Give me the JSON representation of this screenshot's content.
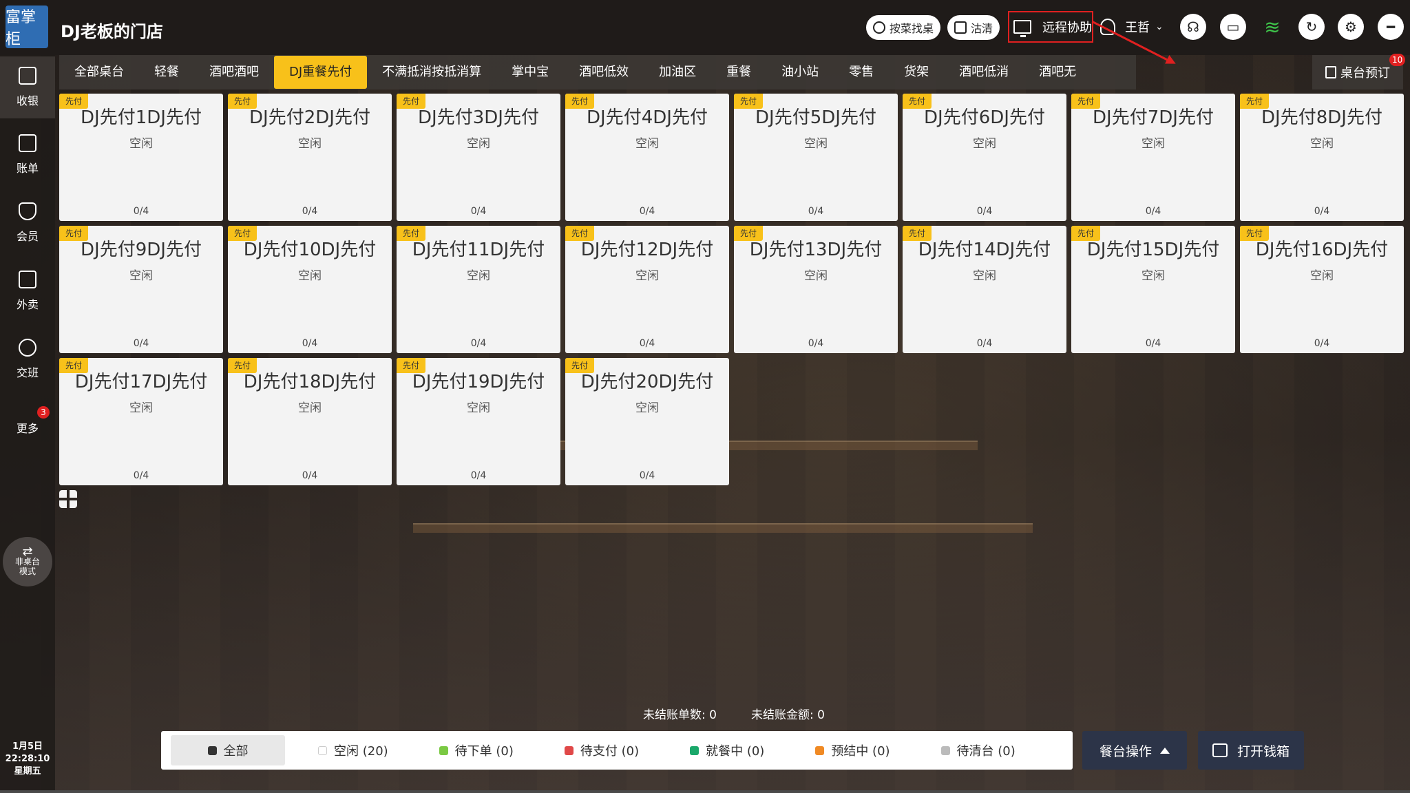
{
  "header": {
    "logo_text": "富掌柜",
    "store_name": "DJ老板的门店",
    "search_dish_label": "按菜找桌",
    "clean_label": "沽清",
    "remote_assist_label": "远程协助",
    "user_name": "王哲"
  },
  "sidebar": {
    "items": [
      {
        "label": "收银"
      },
      {
        "label": "账单"
      },
      {
        "label": "会员"
      },
      {
        "label": "外卖"
      },
      {
        "label": "交班"
      },
      {
        "label": "更多",
        "badge": "3"
      }
    ],
    "mode_label_1": "非桌台",
    "mode_label_2": "模式",
    "date": "1月5日",
    "time": "22:28:10",
    "weekday": "星期五"
  },
  "tabs": [
    "全部桌台",
    "轻餐",
    "酒吧酒吧",
    "DJ重餐先付",
    "不满抵消按抵消算",
    "掌中宝",
    "酒吧低效",
    "加油区",
    "重餐",
    "油小站",
    "零售",
    "货架",
    "酒吧低消",
    "酒吧无"
  ],
  "active_tab": "DJ重餐先付",
  "reserve": {
    "label": "桌台预订",
    "badge": "10"
  },
  "tables": [
    {
      "tag": "先付",
      "name": "DJ先付1DJ先付",
      "status": "空闲",
      "seats": "0/4"
    },
    {
      "tag": "先付",
      "name": "DJ先付2DJ先付",
      "status": "空闲",
      "seats": "0/4"
    },
    {
      "tag": "先付",
      "name": "DJ先付3DJ先付",
      "status": "空闲",
      "seats": "0/4"
    },
    {
      "tag": "先付",
      "name": "DJ先付4DJ先付",
      "status": "空闲",
      "seats": "0/4"
    },
    {
      "tag": "先付",
      "name": "DJ先付5DJ先付",
      "status": "空闲",
      "seats": "0/4"
    },
    {
      "tag": "先付",
      "name": "DJ先付6DJ先付",
      "status": "空闲",
      "seats": "0/4"
    },
    {
      "tag": "先付",
      "name": "DJ先付7DJ先付",
      "status": "空闲",
      "seats": "0/4"
    },
    {
      "tag": "先付",
      "name": "DJ先付8DJ先付",
      "status": "空闲",
      "seats": "0/4"
    },
    {
      "tag": "先付",
      "name": "DJ先付9DJ先付",
      "status": "空闲",
      "seats": "0/4"
    },
    {
      "tag": "先付",
      "name": "DJ先付10DJ先付",
      "status": "空闲",
      "seats": "0/4"
    },
    {
      "tag": "先付",
      "name": "DJ先付11DJ先付",
      "status": "空闲",
      "seats": "0/4"
    },
    {
      "tag": "先付",
      "name": "DJ先付12DJ先付",
      "status": "空闲",
      "seats": "0/4"
    },
    {
      "tag": "先付",
      "name": "DJ先付13DJ先付",
      "status": "空闲",
      "seats": "0/4"
    },
    {
      "tag": "先付",
      "name": "DJ先付14DJ先付",
      "status": "空闲",
      "seats": "0/4"
    },
    {
      "tag": "先付",
      "name": "DJ先付15DJ先付",
      "status": "空闲",
      "seats": "0/4"
    },
    {
      "tag": "先付",
      "name": "DJ先付16DJ先付",
      "status": "空闲",
      "seats": "0/4"
    },
    {
      "tag": "先付",
      "name": "DJ先付17DJ先付",
      "status": "空闲",
      "seats": "0/4"
    },
    {
      "tag": "先付",
      "name": "DJ先付18DJ先付",
      "status": "空闲",
      "seats": "0/4"
    },
    {
      "tag": "先付",
      "name": "DJ先付19DJ先付",
      "status": "空闲",
      "seats": "0/4"
    },
    {
      "tag": "先付",
      "name": "DJ先付20DJ先付",
      "status": "空闲",
      "seats": "0/4"
    }
  ],
  "summary": {
    "unsettled_orders": "未结账单数: 0",
    "unsettled_amount": "未结账金额: 0"
  },
  "legend": [
    {
      "label": "全部",
      "color": "#333333"
    },
    {
      "label": "空闲 (20)",
      "color": "#ffffff"
    },
    {
      "label": "待下单 (0)",
      "color": "#7ac943"
    },
    {
      "label": "待支付 (0)",
      "color": "#e04848"
    },
    {
      "label": "就餐中 (0)",
      "color": "#1aa86a"
    },
    {
      "label": "预结中 (0)",
      "color": "#f08a24"
    },
    {
      "label": "待清台 (0)",
      "color": "#bbbbbb"
    }
  ],
  "actions": {
    "table_ops_label": "餐台操作",
    "open_drawer_label": "打开钱箱"
  },
  "colors": {
    "accent": "#f8c11a",
    "alert": "#e02020",
    "action_button": "#2c3448"
  }
}
